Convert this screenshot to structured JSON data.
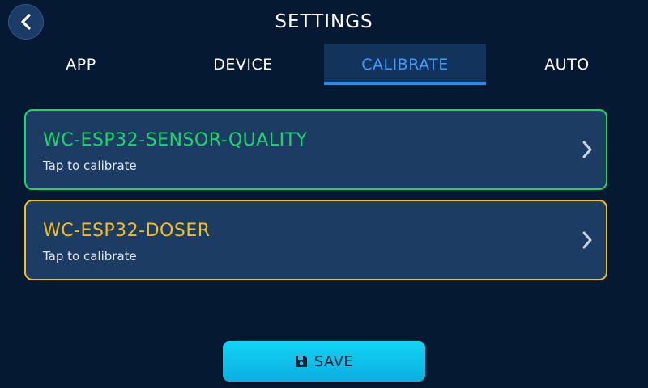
{
  "header": {
    "title": "SETTINGS",
    "back_icon": "chevron-left-icon"
  },
  "tabs": [
    {
      "label": "APP",
      "active": false
    },
    {
      "label": "DEVICE",
      "active": false
    },
    {
      "label": "CALIBRATE",
      "active": true
    },
    {
      "label": "AUTO",
      "active": false
    }
  ],
  "devices": [
    {
      "name": "WC-ESP32-SENSOR-QUALITY",
      "subtitle": "Tap to calibrate",
      "color": "#19d86a",
      "icon": "chevron-right-icon"
    },
    {
      "name": "WC-ESP32-DOSER",
      "subtitle": "Tap to calibrate",
      "color": "#f4bf1c",
      "icon": "chevron-right-icon"
    }
  ],
  "save": {
    "label": "SAVE",
    "icon": "floppy-disk-icon"
  },
  "colors": {
    "background": "#051933",
    "card": "#1c3c64",
    "accent": "#2b8de6",
    "active_tab_text": "#3d9bff",
    "save_button": "#13c6ee"
  }
}
